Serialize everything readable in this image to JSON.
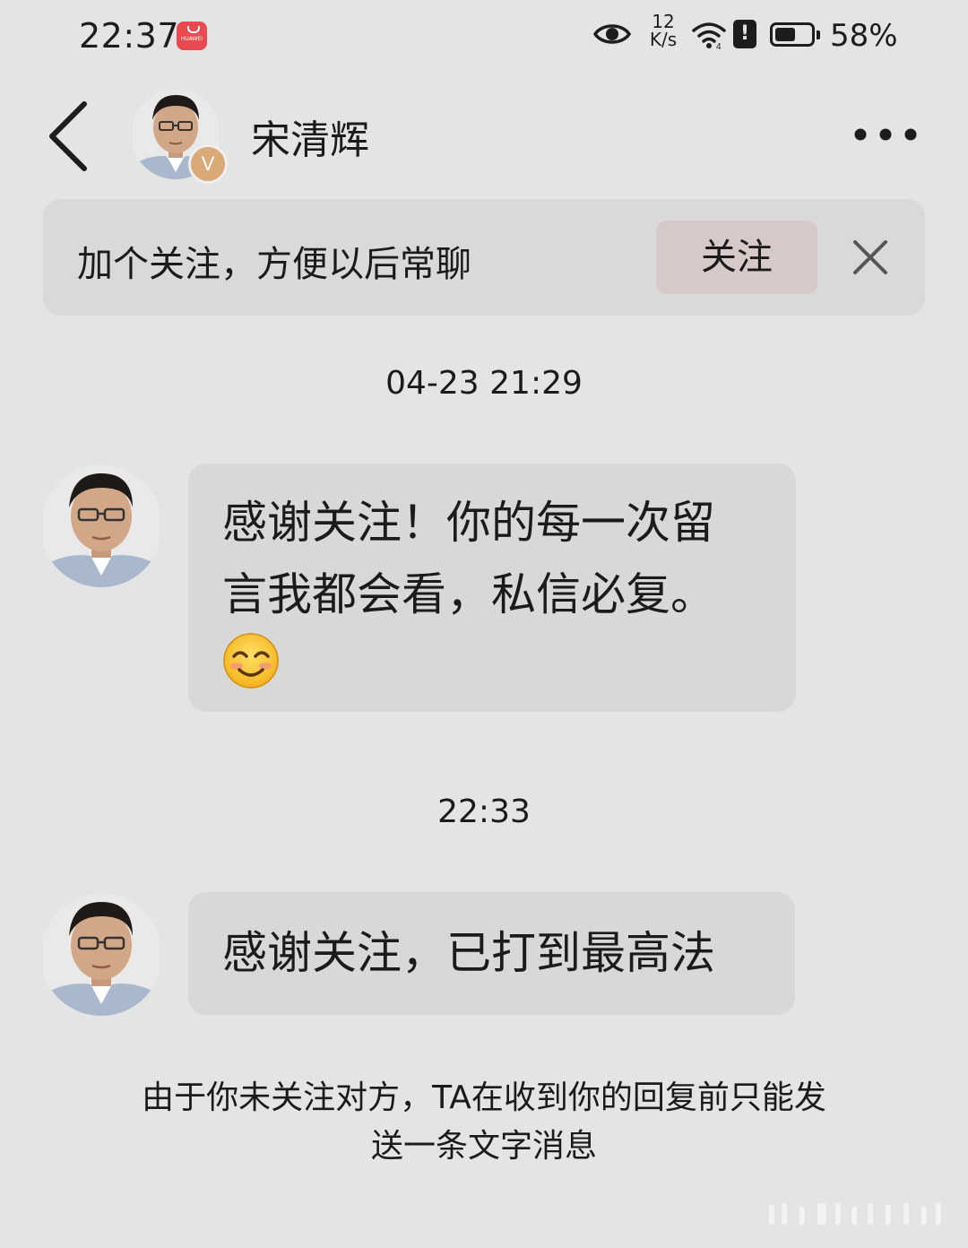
{
  "status_bar": {
    "time": "22:37",
    "app_badge_text": "HUAWEI",
    "net_speed_value": "12",
    "net_speed_unit": "K/s",
    "battery_percent": "58%",
    "battery_level": 0.58
  },
  "header": {
    "name": "宋清辉",
    "verified_badge": "V"
  },
  "follow_banner": {
    "text": "加个关注，方便以后常聊",
    "button_label": "关注"
  },
  "messages": [
    {
      "timestamp": "04-23 21:29",
      "line1": "感谢关注！你的每一次留",
      "line2": "言我都会看，私信必复。",
      "emoji": "smiling-face-icon"
    },
    {
      "timestamp": "22:33",
      "text": "感谢关注，已打到最高法"
    }
  ],
  "notice": {
    "line1": "由于你未关注对方，TA在收到你的回复前只能发",
    "line2": "送一条文字消息"
  },
  "colors": {
    "background": "#e4e4e4",
    "bubble": "#d8d8d8",
    "follow_button": "#d7c9c9",
    "verified": "#d9a978",
    "badge": "#e84a4f"
  }
}
